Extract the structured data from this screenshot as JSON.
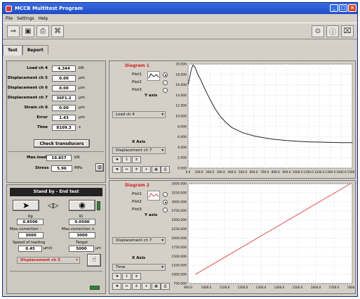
{
  "window": {
    "title": "MCCB Multitest Program",
    "min": "_",
    "max": "□",
    "close": "×"
  },
  "menu": [
    "File",
    "Settings",
    "Help"
  ],
  "tabs": [
    "Test",
    "Report"
  ],
  "readouts": [
    {
      "label": "Load ch 4",
      "value": "4.344",
      "unit": "kN"
    },
    {
      "label": "Displacement ch 5",
      "value": "0.00",
      "unit": "µm"
    },
    {
      "label": "Displacement ch 6",
      "value": "0.00",
      "unit": "µm"
    },
    {
      "label": "Displacement ch 7",
      "value": "36F1.2",
      "unit": "µm"
    },
    {
      "label": "Strain ch 8",
      "value": "0.00",
      "unit": "µm"
    },
    {
      "label": "Error",
      "value": "1.43",
      "unit": "µm"
    },
    {
      "label": "Time",
      "value": "8109.3",
      "unit": "s"
    }
  ],
  "check_transducers": "Check transducers",
  "max_load": {
    "label": "Max.load",
    "value": "19.857",
    "unit": "kN"
  },
  "stress": {
    "label": "Stress",
    "value": "5.96",
    "unit": "MPa"
  },
  "status": "Stand by - End test",
  "kp": {
    "label": "Kp",
    "value": "0.9500"
  },
  "ki": {
    "label": "Ki",
    "value": "0.0500"
  },
  "max_corr_minus": {
    "label": "Max.correction -",
    "value": "3000"
  },
  "max_corr_plus": {
    "label": "Max.correction +",
    "value": "3000"
  },
  "speed": {
    "label": "Speed of loading",
    "value": "0.45",
    "unit": "µm/s"
  },
  "target": {
    "label": "Target",
    "value": "5000",
    "unit": "µm"
  },
  "control_channel": "Displacement ch 5",
  "diagram1": {
    "title": "Diagram 1",
    "plots": [
      "Plot1",
      "Plot2",
      "Plot3"
    ],
    "y_axis_label": "Y axis",
    "y_select": "Load ch 4",
    "x_axis_label": "X Axis",
    "x_select": "Displacement ch 7",
    "yticks": [
      "20.000",
      "18.000",
      "16.000",
      "14.000",
      "12.000",
      "10.000",
      "8.000",
      "6.000",
      "4.000",
      "2.000",
      "0.000"
    ],
    "xticks": [
      "0.0",
      "100.0",
      "200.0",
      "300.0",
      "400.0",
      "500.0",
      "600.0",
      "700.0",
      "800.0",
      "900.0",
      "1000.0",
      "1100.0",
      "1200.0",
      "1300.0",
      "1400.0",
      "1500.0"
    ]
  },
  "diagram2": {
    "title": "Diagram 2",
    "plots": [
      "Plot1",
      "Plot2",
      "Plot3"
    ],
    "y_axis_label": "Y axis",
    "y_select": "Displacement ch 7",
    "x_axis_label": "X Axis",
    "x_select": "Time",
    "yticks": [
      "3500.000",
      "3250.000",
      "3000.000",
      "2750.000",
      "2500.000",
      "2250.000",
      "2000.000",
      "1750.000",
      "1500.000",
      "1250.000",
      "1000.000",
      "750.000"
    ],
    "xticks": [
      "900.0",
      "1000.0",
      "1100.0",
      "1200.0",
      "1300.0",
      "1400.0",
      "1500.0",
      "1600.0",
      "1700.0",
      "1800.0"
    ]
  },
  "colors": {
    "title": "#2553d0",
    "plot_line": "#222222",
    "diag2_line": "#d84a4a",
    "accent_red": "#d31f1f",
    "ok_green": "#2a8a2a"
  },
  "chart_data": [
    {
      "type": "line",
      "title": "Diagram 1",
      "xlabel": "Displacement ch 7",
      "ylabel": "Load ch 4",
      "xlim": [
        0,
        1500
      ],
      "ylim": [
        0,
        20
      ],
      "x": [
        0,
        30,
        45,
        60,
        75,
        90,
        110,
        140,
        170,
        200,
        250,
        300,
        350,
        400,
        500,
        600,
        700,
        800,
        900,
        1000,
        1100,
        1200,
        1300,
        1400,
        1500
      ],
      "y": [
        16.0,
        19.0,
        19.8,
        19.5,
        18.8,
        18.0,
        17.2,
        15.8,
        14.5,
        13.2,
        11.3,
        9.8,
        8.7,
        7.8,
        6.8,
        6.2,
        5.8,
        5.5,
        5.3,
        5.15,
        5.05,
        5.0,
        4.95,
        4.9,
        4.9
      ],
      "grid": true
    },
    {
      "type": "line",
      "title": "Diagram 2",
      "xlabel": "Time",
      "ylabel": "Displacement ch 7",
      "xlim": [
        900,
        1800
      ],
      "ylim": [
        750,
        3500
      ],
      "x": [
        940,
        1790
      ],
      "y": [
        1000,
        3500
      ],
      "grid": true
    }
  ]
}
